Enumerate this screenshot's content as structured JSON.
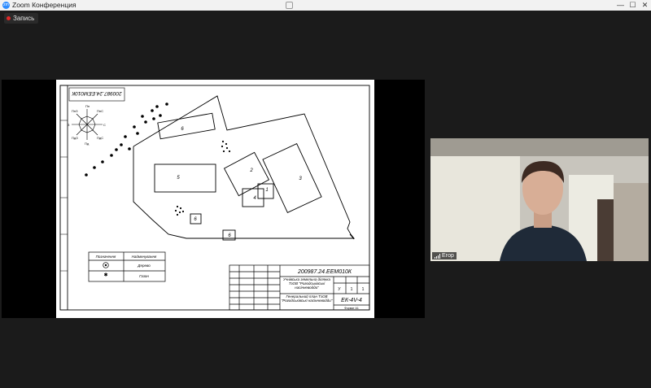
{
  "window": {
    "title": "Zoom Конференция",
    "app_icon_text": "zm",
    "minimize": "—",
    "maximize": "☐",
    "close": "✕"
  },
  "recording": {
    "label": "Запись",
    "color": "#e02828"
  },
  "drawing": {
    "stamp_top": "200987.24.ЕЕМ010К",
    "title_block": {
      "code": "200987.24.ЕЕМ010К",
      "project": "Учнівська земельна ділянка ТзОВ \"Рогодськівські насінневодди\"",
      "sheet_title": "Генеральний план ТзОВ \"Рогодськівські насінневодди\"",
      "group": "ЕК-4V-4",
      "stage": "У",
      "sheet": "1",
      "sheets": "1",
      "format": "Формат  А1"
    },
    "buildings": [
      "6",
      "5",
      "2",
      "3",
      "4",
      "1",
      "6",
      "6"
    ],
    "compass": [
      "Пн",
      "ПнЗ",
      "З",
      "ПдЗ",
      "Пд",
      "ПдС",
      "С",
      "ПнС"
    ],
    "legend": {
      "col1": "Позначення",
      "col2": "Найменування",
      "rows": [
        {
          "symbol": "tree-symbol",
          "name": "Дерево"
        },
        {
          "symbol": "lawn-symbol",
          "name": "Газон"
        }
      ]
    }
  },
  "participant": {
    "name": "Егор"
  },
  "colors": {
    "share_bg": "#000000",
    "app_bg": "#1b1b1b",
    "accent": "#2d8cff"
  }
}
